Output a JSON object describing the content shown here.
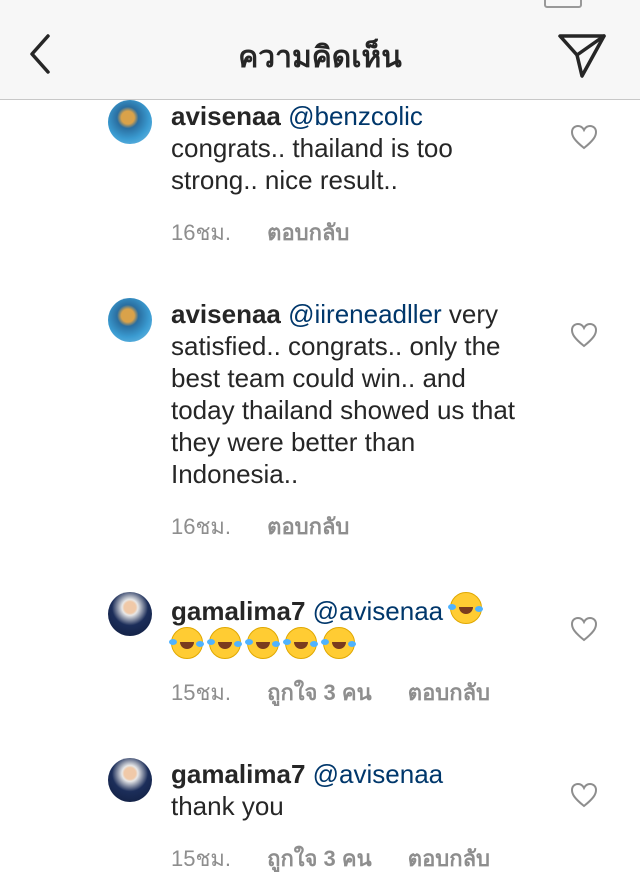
{
  "header": {
    "title": "ความคิดเห็น",
    "back_icon": "chevron-left-icon",
    "send_icon": "paper-plane-icon"
  },
  "comments": [
    {
      "username": "avisenaa",
      "mention": "@benzcolic",
      "text_line1": " ",
      "body": "congrats.. thailand is too strong.. nice result..",
      "time": "16ชม.",
      "likes": "",
      "reply": "ตอบกลับ"
    },
    {
      "username": "avisenaa",
      "mention": "@iireneadller",
      "body": "very satisfied.. congrats.. only the best team could win.. and today thailand showed us that they were better than Indonesia..",
      "time": "16ชม.",
      "likes": "",
      "reply": "ตอบกลับ"
    },
    {
      "username": "gamalima7",
      "mention": "@avisenaa",
      "emoji": "🤣",
      "emoji_count": 6,
      "time": "15ชม.",
      "likes": "ถูกใจ 3 คน",
      "reply": "ตอบกลับ"
    },
    {
      "username": "gamalima7",
      "mention": "@avisenaa",
      "body": "thank you",
      "time": "15ชม.",
      "likes": "ถูกใจ 3 คน",
      "reply": "ตอบกลับ"
    }
  ],
  "colors": {
    "mention": "#00376b",
    "secondary": "#8e8e8e",
    "header_bg": "#f7f7f7"
  }
}
